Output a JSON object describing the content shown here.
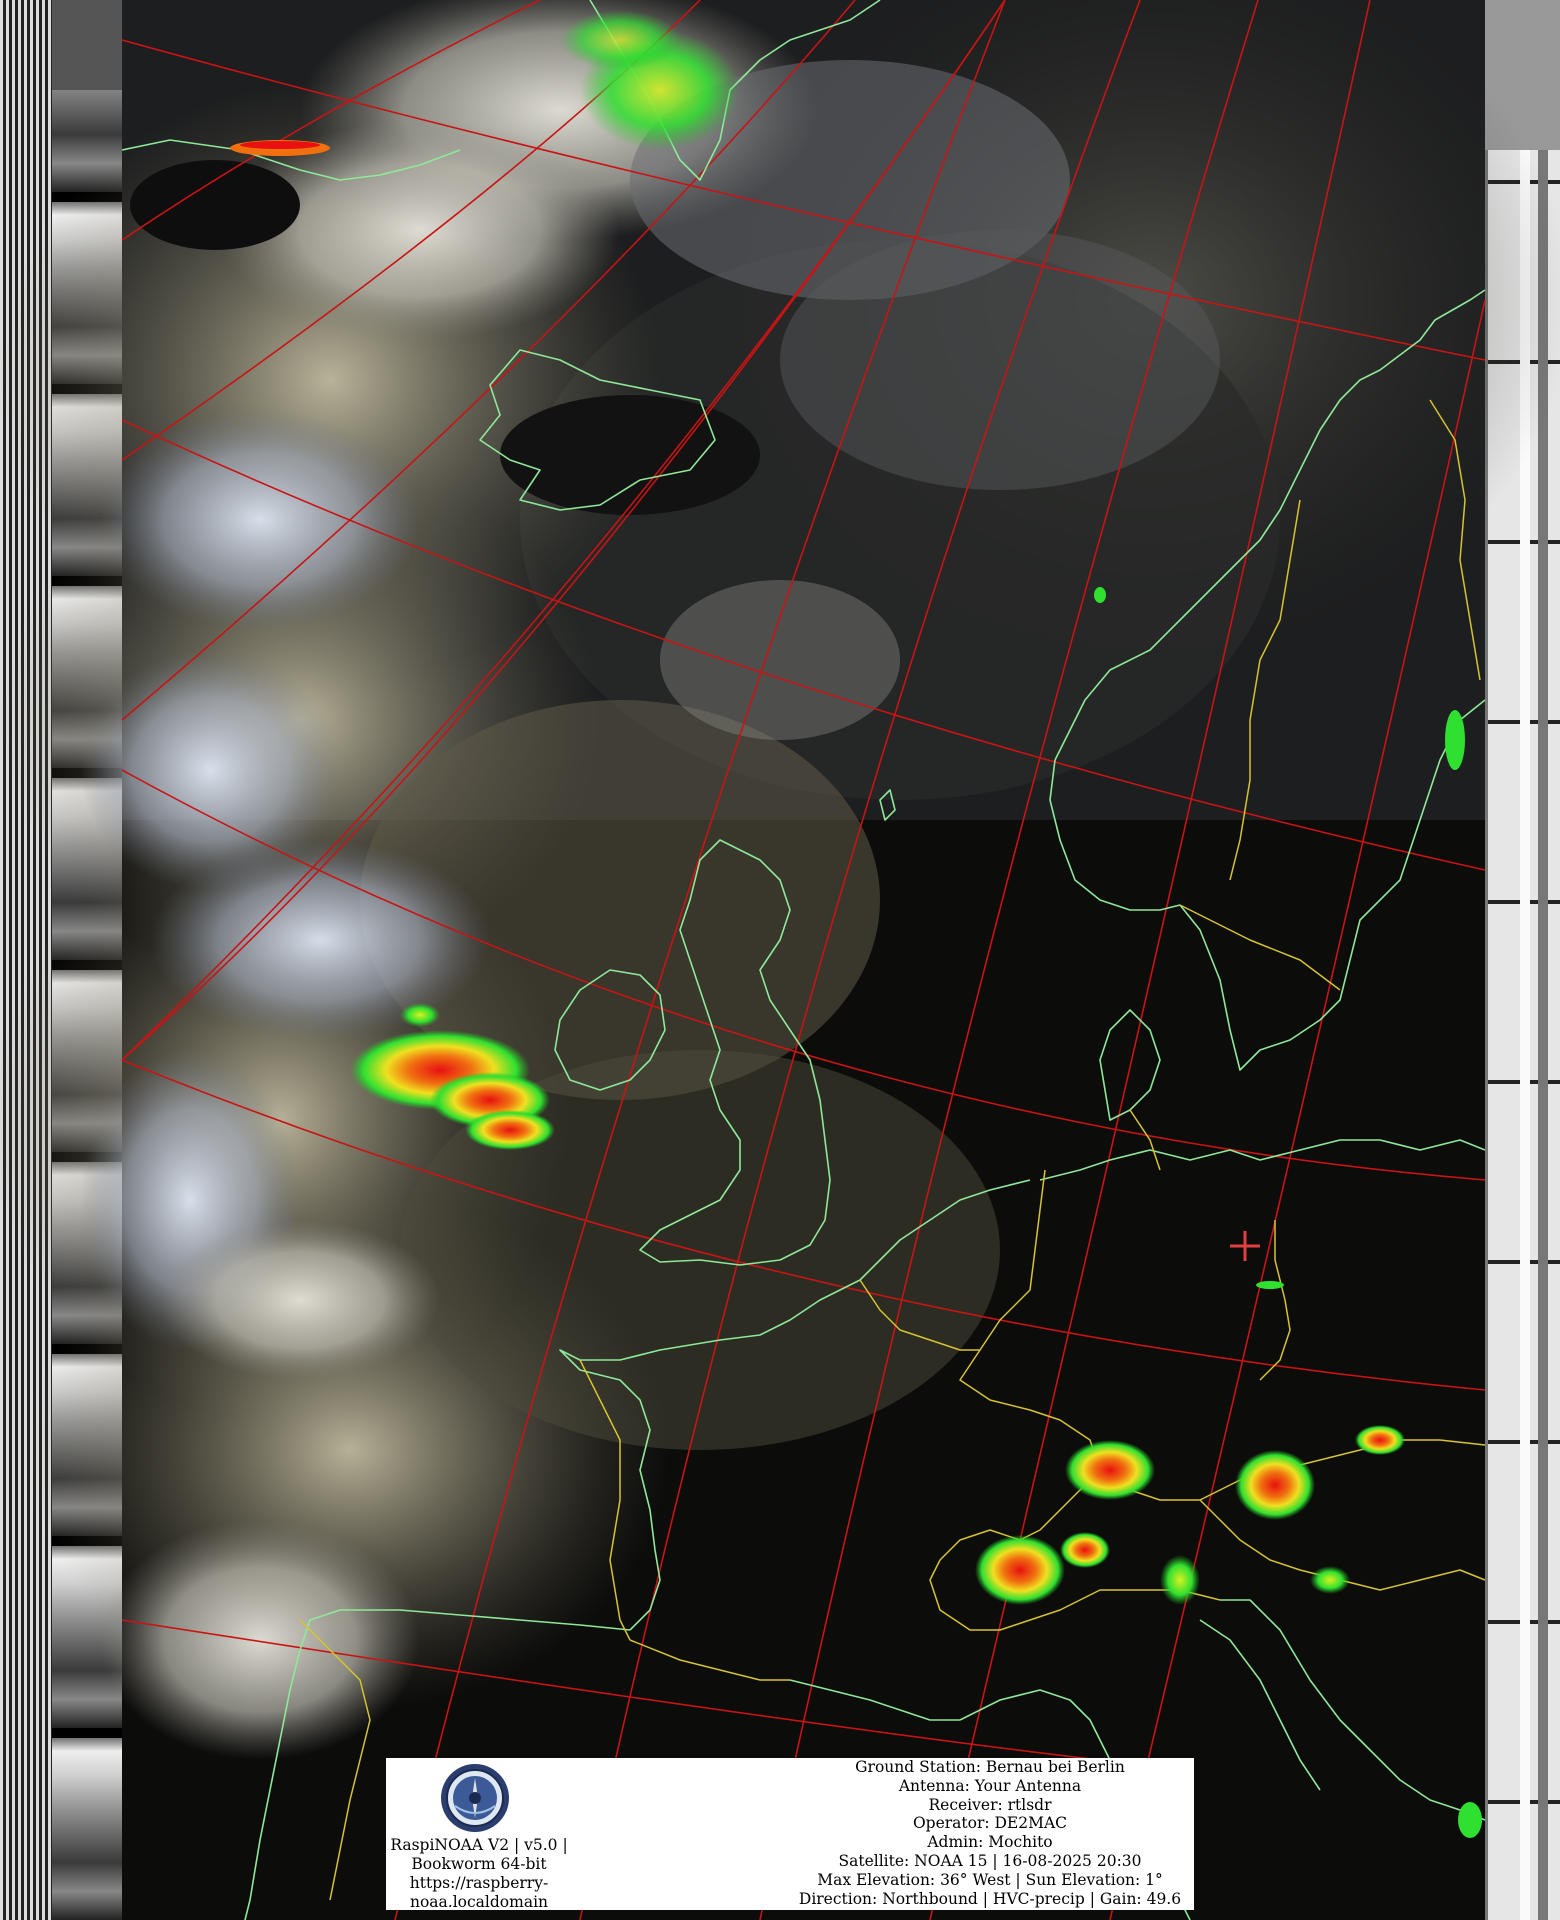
{
  "image": {
    "type": "NOAA APT weather satellite composite",
    "colors": {
      "grid": "#c81414",
      "coastline": "#8fe89a",
      "border": "#d6c432",
      "ground_station_marker": "#e04040",
      "precip_low": "#22ee22",
      "precip_mid": "#f0e020",
      "precip_high": "#e81010",
      "ocean": "#0b0b0b",
      "cloud": "#c8c6b8"
    }
  },
  "panel": {
    "logo_icon": "raspinoaa-seal-icon",
    "software": {
      "line1": "RaspiNOAA V2 | v5.0 |",
      "line2": "Bookworm 64-bit",
      "line3": "https://raspberry-",
      "line4": "noaa.localdomain"
    },
    "pass": {
      "ground_station": "Ground Station: Bernau bei Berlin",
      "antenna": "Antenna: Your Antenna",
      "receiver": "Receiver: rtlsdr",
      "operator": "Operator: DE2MAC",
      "admin": "Admin: Mochito",
      "satellite": "Satellite: NOAA 15 | 16-08-2025 20:30",
      "elevation": "Max Elevation: 36° West | Sun Elevation: 1°",
      "direction": "Direction: Northbound | HVC-precip | Gain: 49.6"
    }
  }
}
